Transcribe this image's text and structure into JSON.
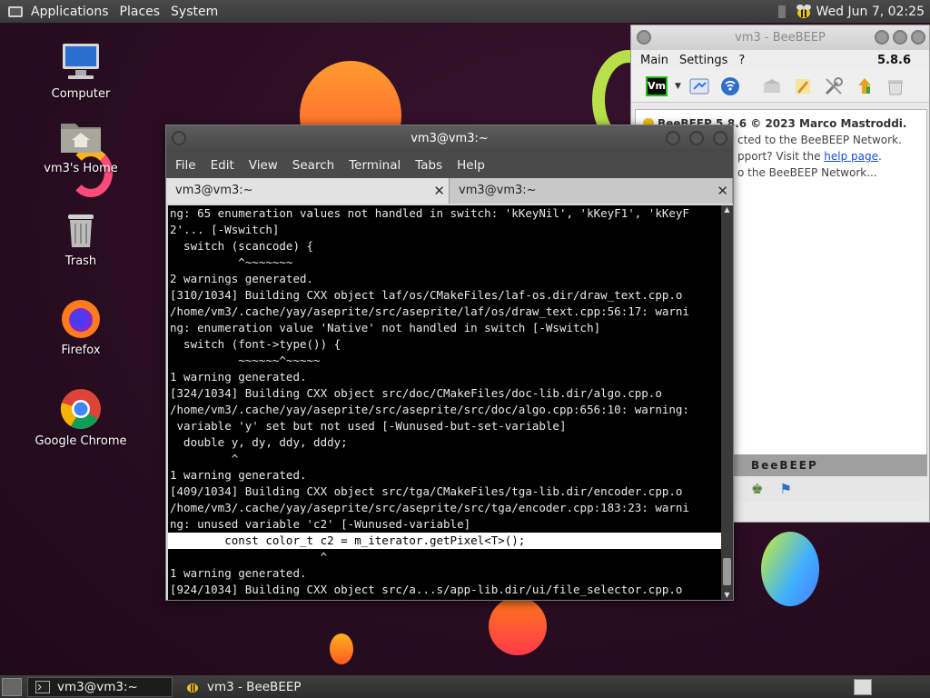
{
  "top_panel": {
    "menus": [
      "Applications",
      "Places",
      "System"
    ],
    "clock": "Wed Jun  7, 02:25"
  },
  "desktop_icons": [
    {
      "label": "Computer",
      "icon": "computer-icon"
    },
    {
      "label": "vm3's Home",
      "icon": "home-folder-icon"
    },
    {
      "label": "Trash",
      "icon": "trash-icon"
    },
    {
      "label": "Firefox",
      "icon": "firefox-icon"
    },
    {
      "label": "Google Chrome",
      "icon": "chrome-icon"
    }
  ],
  "beebeep": {
    "title": "vm3 - BeeBEEP",
    "menu": [
      "Main",
      "Settings",
      "?"
    ],
    "version": "5.8.6",
    "status_badge": "Vm",
    "content": {
      "heading": "BeeBEEP 5.8.6 © 2023 Marco Mastroddi.",
      "line1": "cted to the BeeBEEP Network.",
      "line2_prefix": "pport? Visit the ",
      "line2_link": "help page",
      "line2_suffix": ".",
      "line3": "o the BeeBEEP Network..."
    },
    "logo_text": "BeeBEEP",
    "colors": {
      "accent_green": "#22c01a",
      "link": "#1a4fd6"
    }
  },
  "terminal": {
    "title": "vm3@vm3:~",
    "menu": [
      "File",
      "Edit",
      "View",
      "Search",
      "Terminal",
      "Tabs",
      "Help"
    ],
    "tabs": [
      {
        "label": "vm3@vm3:~",
        "close": "✕"
      },
      {
        "label": "vm3@vm3:~",
        "close": "✕"
      }
    ],
    "lines": [
      "ng: 65 enumeration values not handled in switch: 'kKeyNil', 'kKeyF1', 'kKeyF",
      "2'... [-Wswitch]",
      "  switch (scancode) {",
      "          ^~~~~~~~",
      "2 warnings generated.",
      "[310/1034] Building CXX object laf/os/CMakeFiles/laf-os.dir/draw_text.cpp.o",
      "/home/vm3/.cache/yay/aseprite/src/aseprite/laf/os/draw_text.cpp:56:17: warni",
      "ng: enumeration value 'Native' not handled in switch [-Wswitch]",
      "  switch (font->type()) {",
      "          ~~~~~~^~~~~~",
      "1 warning generated.",
      "[324/1034] Building CXX object src/doc/CMakeFiles/doc-lib.dir/algo.cpp.o",
      "/home/vm3/.cache/yay/aseprite/src/aseprite/src/doc/algo.cpp:656:10: warning:",
      " variable 'y' set but not used [-Wunused-but-set-variable]",
      "  double y, dy, ddy, dddy;",
      "         ^",
      "1 warning generated.",
      "[409/1034] Building CXX object src/tga/CMakeFiles/tga-lib.dir/encoder.cpp.o",
      "/home/vm3/.cache/yay/aseprite/src/aseprite/src/tga/encoder.cpp:183:23: warni",
      "ng: unused variable 'c2' [-Wunused-variable]",
      "        const color_t c2 = m_iterator.getPixel<T>();",
      "                      ^",
      "1 warning generated.",
      "[924/1034] Building CXX object src/a...s/app-lib.dir/ui/file_selector.cpp.o"
    ],
    "highlighted_line_index": 20
  },
  "taskbar": {
    "tasks": [
      {
        "label": "vm3@vm3:~",
        "icon": "terminal-icon",
        "active": true
      },
      {
        "label": "vm3 - BeeBEEP",
        "icon": "bee-icon",
        "active": false
      }
    ]
  }
}
